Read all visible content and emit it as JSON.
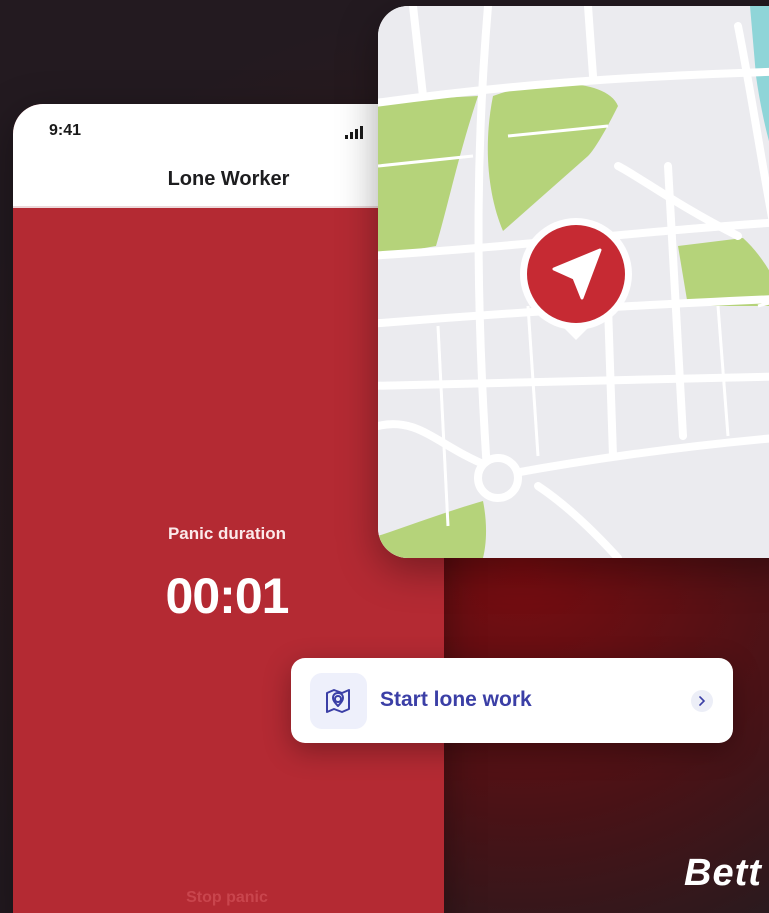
{
  "phone": {
    "status_time": "9:41",
    "title": "Lone Worker",
    "panic_label": "Panic duration",
    "panic_timer": "00:01",
    "stop_button": "Stop panic"
  },
  "map": {
    "marker_icon": "navigation-arrow-icon",
    "colors": {
      "park": "#b5d37a",
      "water": "#8fd5d8",
      "marker": "#c62a33",
      "roads": "#ffffff",
      "land": "#ebebef"
    }
  },
  "action": {
    "label": "Start lone work",
    "icon": "map-pin-icon",
    "chevron_icon": "chevron-right-icon"
  },
  "brand": {
    "text": "Bett"
  }
}
